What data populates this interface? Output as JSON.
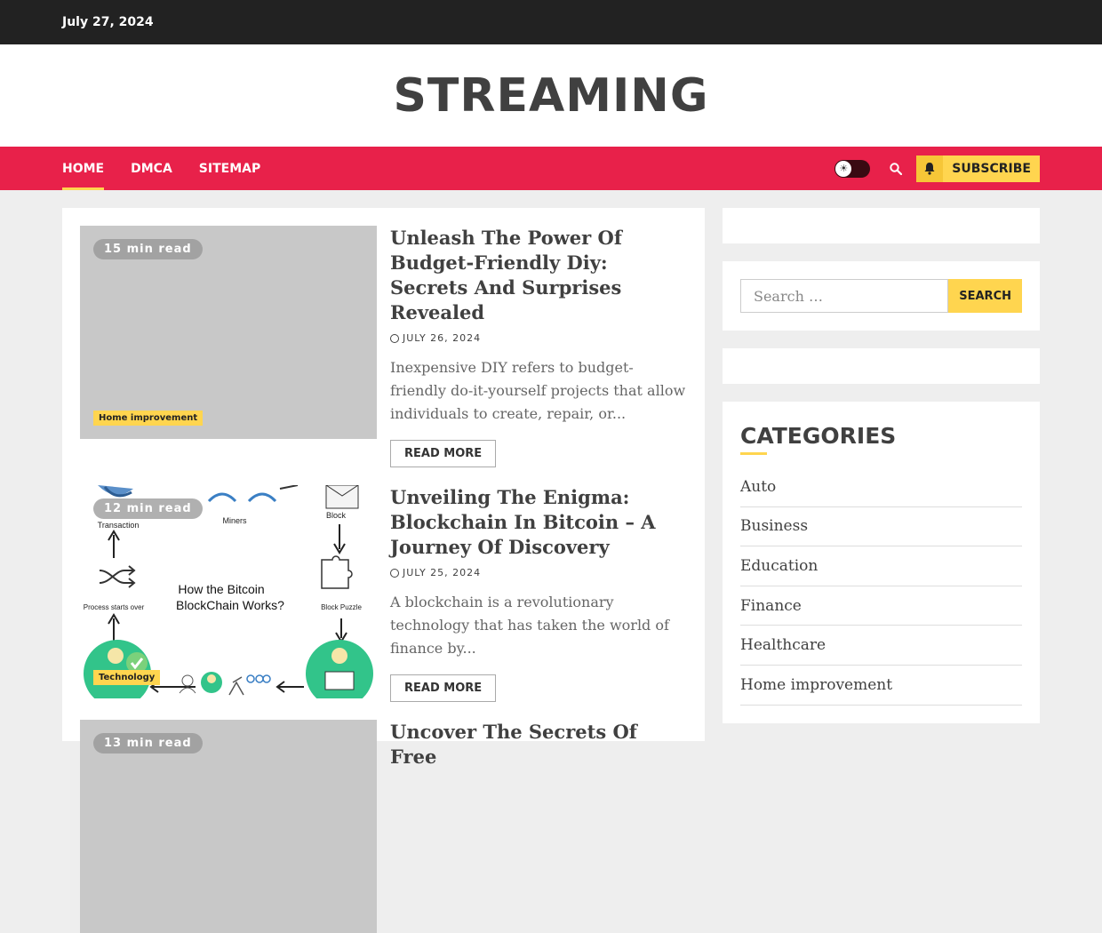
{
  "topbar": {
    "date": "July 27, 2024"
  },
  "header": {
    "site_title": "STREAMING"
  },
  "nav": {
    "items": [
      {
        "label": "Home"
      },
      {
        "label": "DMCA"
      },
      {
        "label": "Sitemap"
      }
    ],
    "subscribe_label": "Subscribe"
  },
  "posts": [
    {
      "read_time": "15 min read",
      "category": "Home improvement",
      "title": "Unleash The Power Of Budget-Friendly Diy: Secrets And Surprises Revealed",
      "date": "July 26, 2024",
      "excerpt": "Inexpensive DIY refers to budget-friendly do-it-yourself projects that allow individuals to create, repair, or...",
      "read_more": "Read More"
    },
    {
      "read_time": "12 min read",
      "category": "Technology",
      "title": "Unveiling The Enigma: Blockchain In Bitcoin – A Journey Of Discovery",
      "date": "July 25, 2024",
      "excerpt": "A blockchain is a revolutionary technology that has taken the world of finance by...",
      "read_more": "Read More",
      "image_labels": {
        "transaction": "Transaction",
        "miners": "Miners",
        "block": "Block",
        "center_line1": "How the Bitcoin",
        "center_line2": "BlockChain Works?",
        "process": "Process starts over",
        "puzzle": "Block Puzzle"
      }
    },
    {
      "read_time": "13 min read",
      "title": "Uncover The Secrets Of Free"
    }
  ],
  "sidebar": {
    "search_placeholder": "Search …",
    "search_button": "Search",
    "categories_title": "Categories",
    "categories": [
      "Auto",
      "Business",
      "Education",
      "Finance",
      "Healthcare",
      "Home improvement"
    ]
  },
  "colors": {
    "accent": "#e8214a",
    "highlight": "#ffd54f",
    "topbar": "#222222"
  }
}
